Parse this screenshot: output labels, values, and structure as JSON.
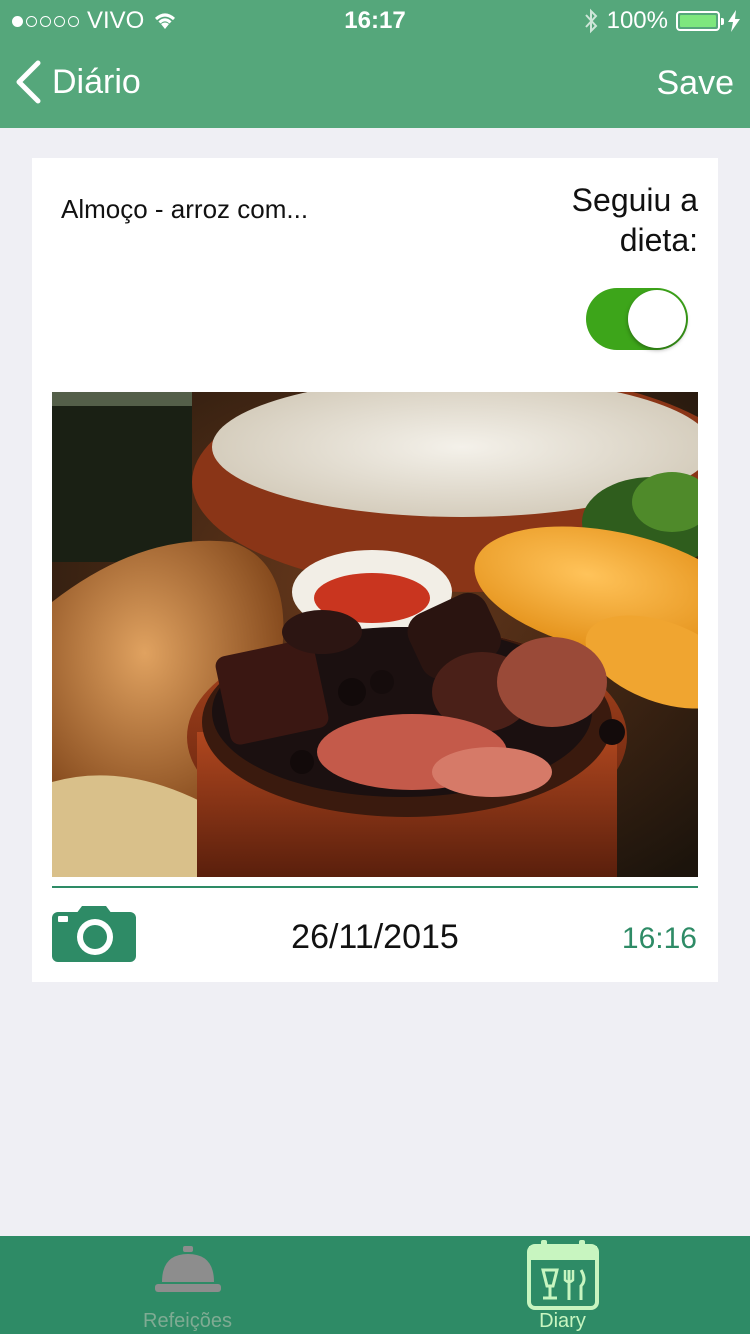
{
  "status": {
    "carrier": "VIVO",
    "time": "16:17",
    "battery": "100%"
  },
  "nav": {
    "back_label": "Diário",
    "save_label": "Save"
  },
  "entry": {
    "title": "Almoço - arroz com...",
    "diet_label": "Seguiu a dieta:",
    "diet_followed": true,
    "date": "26/11/2015",
    "time": "16:16"
  },
  "tabs": [
    {
      "label": "Refeições",
      "icon": "service-bell-icon",
      "selected": false
    },
    {
      "label": "Diary",
      "icon": "calendar-utensils-icon",
      "selected": true
    }
  ],
  "colors": {
    "header": "#55a77b",
    "tabbar": "#2e8b66",
    "accent": "#2e8b66",
    "toggle_on": "#3da51a"
  }
}
